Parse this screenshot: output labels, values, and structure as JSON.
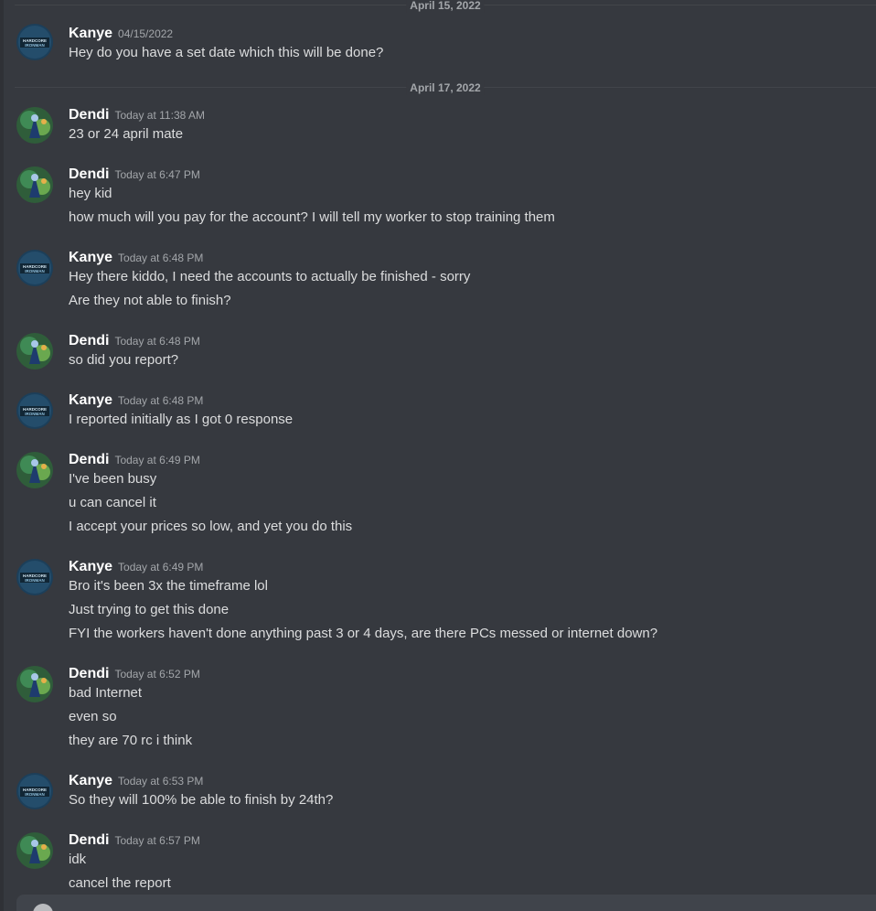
{
  "dividers": {
    "d1": "April 15, 2022",
    "d2": "April 17, 2022"
  },
  "messages": [
    {
      "author": "Kanye",
      "time": "04/15/2022",
      "lines": [
        "Hey do you have a set date which this will be done?"
      ]
    },
    {
      "author": "Dendi",
      "time": "Today at 11:38 AM",
      "lines": [
        "23 or 24 april mate"
      ]
    },
    {
      "author": "Dendi",
      "time": "Today at 6:47 PM",
      "lines": [
        "hey kid",
        "how much will you pay for the account? I will tell my worker to stop training them"
      ]
    },
    {
      "author": "Kanye",
      "time": "Today at 6:48 PM",
      "lines": [
        "Hey there kiddo, I need the accounts to actually be finished - sorry",
        "Are they not able to finish?"
      ]
    },
    {
      "author": "Dendi",
      "time": "Today at 6:48 PM",
      "lines": [
        "so did you report?"
      ]
    },
    {
      "author": "Kanye",
      "time": "Today at 6:48 PM",
      "lines": [
        "I reported initially as I got 0 response"
      ]
    },
    {
      "author": "Dendi",
      "time": "Today at 6:49 PM",
      "lines": [
        "I've been busy",
        "u can cancel it",
        "I accept your prices so low, and yet you do this"
      ]
    },
    {
      "author": "Kanye",
      "time": "Today at 6:49 PM",
      "lines": [
        "Bro it's been 3x the timeframe lol",
        "Just trying to get this done",
        "FYI the workers haven't done anything past 3 or 4 days, are there PCs messed or internet down?"
      ]
    },
    {
      "author": "Dendi",
      "time": "Today at 6:52 PM",
      "lines": [
        "bad Internet",
        "even so",
        "they are 70 rc i think"
      ]
    },
    {
      "author": "Kanye",
      "time": "Today at 6:53 PM",
      "lines": [
        "So they will 100% be able to finish by 24th?"
      ]
    },
    {
      "author": "Dendi",
      "time": "Today at 6:57 PM",
      "lines": [
        "idk",
        "cancel the report"
      ]
    }
  ],
  "avatars": {
    "kanye_badge_line1": "HARDCORE",
    "kanye_badge_line2": "IRONMAN"
  },
  "colors": {
    "background": "#36393f",
    "username": "#ffffff",
    "timestamp": "#a3a6aa",
    "text": "#dcddde"
  }
}
